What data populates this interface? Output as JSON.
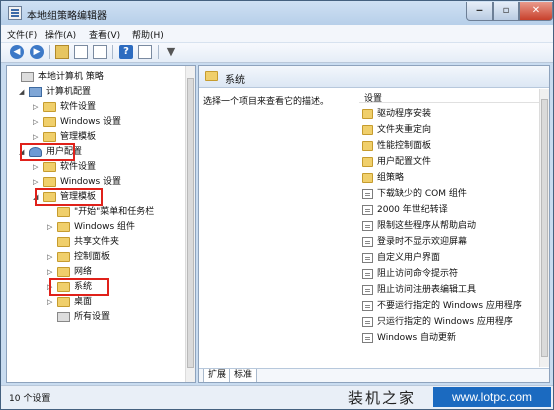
{
  "window": {
    "title": "本地组策略编辑器"
  },
  "menu": [
    "文件(F)",
    "操作(A)",
    "查看(V)",
    "帮助(H)"
  ],
  "tree": [
    {
      "label": "本地计算机 策略",
      "icon": "policy-icon",
      "exp": ""
    },
    {
      "label": "计算机配置",
      "icon": "computer-icon",
      "exp": "◢"
    },
    {
      "label": "软件设置",
      "icon": "folder-icon",
      "exp": "▷"
    },
    {
      "label": "Windows 设置",
      "icon": "folder-icon",
      "exp": "▷"
    },
    {
      "label": "管理模板",
      "icon": "folder-icon",
      "exp": "▷"
    },
    {
      "label": "用户配置",
      "icon": "user-icon",
      "exp": "◢"
    },
    {
      "label": "软件设置",
      "icon": "folder-icon",
      "exp": "▷"
    },
    {
      "label": "Windows 设置",
      "icon": "folder-icon",
      "exp": "▷"
    },
    {
      "label": "管理模板",
      "icon": "folder-icon",
      "exp": "◢"
    },
    {
      "label": "\"开始\"菜单和任务栏",
      "icon": "folder-icon",
      "exp": ""
    },
    {
      "label": "Windows 组件",
      "icon": "folder-icon",
      "exp": "▷"
    },
    {
      "label": "共享文件夹",
      "icon": "folder-icon",
      "exp": ""
    },
    {
      "label": "控制面板",
      "icon": "folder-icon",
      "exp": "▷"
    },
    {
      "label": "网络",
      "icon": "folder-icon",
      "exp": "▷"
    },
    {
      "label": "系统",
      "icon": "folder-icon",
      "exp": "▷"
    },
    {
      "label": "桌面",
      "icon": "folder-icon",
      "exp": "▷"
    },
    {
      "label": "所有设置",
      "icon": "settings-icon",
      "exp": ""
    }
  ],
  "right": {
    "header": "系统",
    "description": "选择一个项目来查看它的描述。",
    "column": "设置",
    "items": [
      {
        "label": "驱动程序安装",
        "icon": "folder-icon"
      },
      {
        "label": "文件夹重定向",
        "icon": "folder-icon"
      },
      {
        "label": "性能控制面板",
        "icon": "folder-icon"
      },
      {
        "label": "用户配置文件",
        "icon": "folder-icon"
      },
      {
        "label": "组策略",
        "icon": "folder-icon"
      },
      {
        "label": "下载缺少的 COM 组件",
        "icon": "setting-icon"
      },
      {
        "label": "2000 年世纪转译",
        "icon": "setting-icon"
      },
      {
        "label": "限制这些程序从帮助启动",
        "icon": "setting-icon"
      },
      {
        "label": "登录时不显示欢迎屏幕",
        "icon": "setting-icon"
      },
      {
        "label": "自定义用户界面",
        "icon": "setting-icon"
      },
      {
        "label": "阻止访问命令提示符",
        "icon": "setting-icon"
      },
      {
        "label": "阻止访问注册表编辑工具",
        "icon": "setting-icon"
      },
      {
        "label": "不要运行指定的 Windows 应用程序",
        "icon": "setting-icon"
      },
      {
        "label": "只运行指定的 Windows 应用程序",
        "icon": "setting-icon"
      },
      {
        "label": "Windows 自动更新",
        "icon": "setting-icon"
      }
    ],
    "tabs": [
      "扩展",
      "标准"
    ]
  },
  "status": "10 个设置",
  "watermark": {
    "site": "装机之家",
    "url": "www.lotpc.com"
  }
}
